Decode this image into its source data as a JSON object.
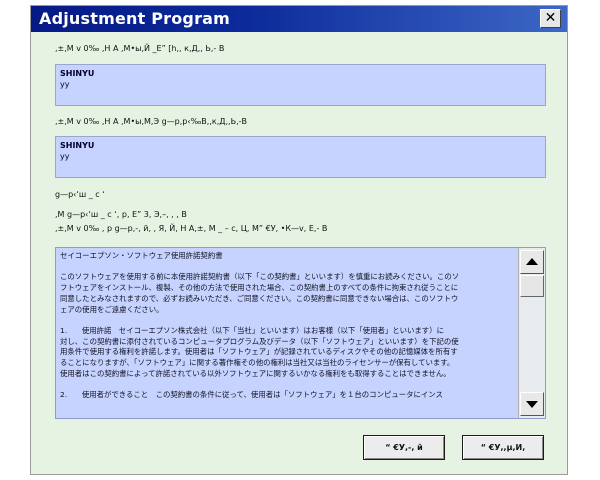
{
  "window": {
    "title": "Adjustment Program",
    "close_glyph": "✕"
  },
  "fields": {
    "label1": ",±,M v 0‰ ,H A ,M•ы,Й _E” [h,, к,Д,, Ь,- В",
    "box1": {
      "name": "SHINYU",
      "value": "уу"
    },
    "label2": ",±,M v 0‰ ,H A ,M•ы,M,Э g—p,р‹‰B,,к,Д,,Ь,-В",
    "box2": {
      "name": "SHINYU",
      "value": "уу"
    },
    "label3": "g—p‹‘ш _ c ʻ",
    "label4": ",M g—p‹‘ш _ c ʻ, p, E” 3, Э,–, , , В",
    "label5": ",±,M v 0‰ , p g—p,-, й, , Я, Й, Н А,±, М _ – с, Ц, М” €У, •К—v, Е,- В"
  },
  "license": {
    "heading": "セイコーエプソン・ソフトウェア使用許諾契約書",
    "para1_lines": [
      "このソフトウェアを使用する前に本使用許諾契約書（以下「この契約書」といいます）を慎重にお読みください。このソ",
      "フトウェアをインストール、複製、その他の方法で使用された場合、この契約書上のすべての条件に拘束され従うことに",
      "同意したとみなされますので、必ずお読みいただき、ご同意ください。この契約書に同意できない場合は、このソフトウ",
      "ェアの使用をご遠慮ください。"
    ],
    "para2_lines": [
      "1.　　使用許諾　セイコーエプソン株式会社（以下「当社」といいます）はお客様（以下「使用者」といいます）に",
      "対し、この契約書に添付されているコンピュータプログラム及びデータ（以下「ソフトウェア」といいます）を下記の使",
      "用条件で使用する権利を許諾します。使用者は「ソフトウェア」が記録されているディスクやその他の記憶媒体を所有す",
      "ることになりますが、「ソフトウェア」に関する著作権その他の権利は当社又は当社のライセンサーが保有しています。",
      "使用者はこの契約書によって許諾されている以外ソフトウェアに関するいかなる権利をも取得することはできません。"
    ],
    "para3_lines": [
      "2.　　使用者ができること　この契約書の条件に従って、使用者は「ソフトウェア」を１台のコンピュータにインス"
    ]
  },
  "buttons": {
    "left_label": "“ €У,-, й",
    "right_label": "“ €У,,µ,И,"
  }
}
